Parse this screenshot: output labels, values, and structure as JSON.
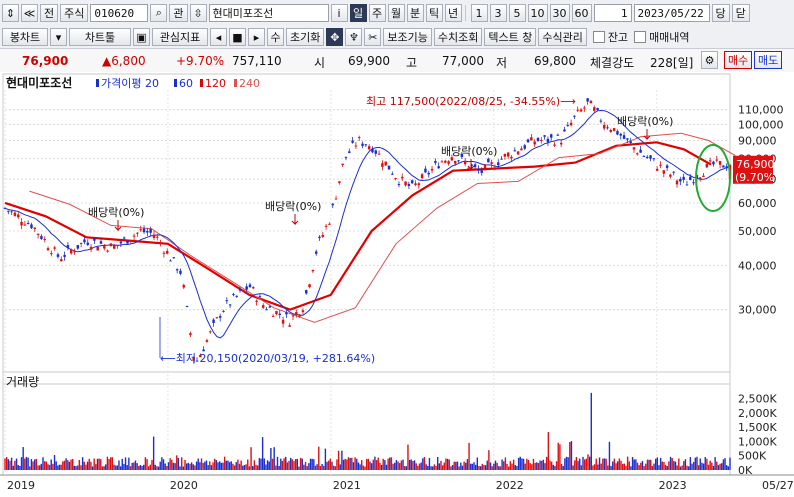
{
  "toolbar1": {
    "nav_up": "⇕",
    "nav_top": "≪",
    "btn_all": "전",
    "btn_stock": "주식",
    "code": "010620",
    "btn_gwan": "관",
    "btn_updown": "⇳",
    "stock_name": "현대미포조선",
    "btn_info": "i",
    "periods": [
      "일",
      "주",
      "월",
      "분",
      "틱",
      "년"
    ],
    "active_period": "일",
    "minute_units": [
      "1",
      "3",
      "5",
      "10",
      "30",
      "60"
    ],
    "count": "1",
    "date": "2023/05/22",
    "btn_dang": "당",
    "btn_close": "닫"
  },
  "toolbar2": {
    "candle": "봉차트",
    "chart_tool": "차트툴",
    "indicator": "관심지표",
    "su": "수",
    "reset": "초기화",
    "sub_func": "보조기능",
    "value_lookup": "수치조회",
    "text_window": "텍스트 창",
    "formula": "수식관리",
    "check_balance": "잔고",
    "check_trades": "매매내역"
  },
  "quote": {
    "price": "76,900",
    "change": "▲6,800",
    "change_pct": "+9.70%",
    "volume": "757,110",
    "open_label": "시",
    "open": "69,900",
    "high_label": "고",
    "high": "77,000",
    "low_label": "저",
    "low": "69,800",
    "strength_label": "체결강도",
    "strength": "228[일]",
    "buy": "매수",
    "sell": "매도"
  },
  "chart_data": {
    "type": "candlestick",
    "title": "현대미포조선",
    "legend": [
      {
        "name": "가격이평",
        "period": "20",
        "color": "#1a2fd0"
      },
      {
        "name": "",
        "period": "60",
        "color": "#1a2fd0"
      },
      {
        "name": "",
        "period": "120",
        "color": "#e00000"
      },
      {
        "name": "",
        "period": "240",
        "color": "#e05050"
      }
    ],
    "price_axis": {
      "scale": "log",
      "ticks": [
        110000,
        100000,
        90000,
        80000,
        70000,
        60000,
        50000,
        40000,
        30000
      ],
      "tick_labels": [
        "110,000",
        "100,000",
        "90,000",
        "80,000",
        "70,000",
        "60,000",
        "50,000",
        "40,000",
        "30,000"
      ]
    },
    "x_axis": {
      "labels": [
        "2019",
        "2020",
        "2021",
        "2022",
        "2023",
        "05/27"
      ]
    },
    "last_price_label": "76,900",
    "last_pct_label": "(9.70%)",
    "annotations": {
      "high": "최고 117,500(2022/08/25, -34.55%)⟶",
      "low": "⟵최저 20,150(2020/03/19, +281.64%)",
      "dividends": [
        "배당락(0%)",
        "배당락(0%)",
        "배당락(0%)",
        "배당락(0%)"
      ]
    },
    "price_path": [
      {
        "date": "2019/01",
        "close": 58000
      },
      {
        "date": "2019/03",
        "close": 52000
      },
      {
        "date": "2019/05",
        "close": 42000
      },
      {
        "date": "2019/07",
        "close": 47000
      },
      {
        "date": "2019/09",
        "close": 45000
      },
      {
        "date": "2019/11",
        "close": 50000
      },
      {
        "date": "2019/12",
        "close": 49000
      },
      {
        "date": "2020/02",
        "close": 38000
      },
      {
        "date": "2020/03",
        "close": 21000
      },
      {
        "date": "2020/05",
        "close": 30000
      },
      {
        "date": "2020/07",
        "close": 35000
      },
      {
        "date": "2020/08",
        "close": 31000
      },
      {
        "date": "2020/10",
        "close": 28000
      },
      {
        "date": "2020/11",
        "close": 31000
      },
      {
        "date": "2020/12",
        "close": 45000
      },
      {
        "date": "2021/01",
        "close": 55000
      },
      {
        "date": "2021/02",
        "close": 80000
      },
      {
        "date": "2021/03",
        "close": 90000
      },
      {
        "date": "2021/04",
        "close": 87000
      },
      {
        "date": "2021/06",
        "close": 70000
      },
      {
        "date": "2021/07",
        "close": 66000
      },
      {
        "date": "2021/09",
        "close": 78000
      },
      {
        "date": "2021/10",
        "close": 82000
      },
      {
        "date": "2021/12",
        "close": 73000
      },
      {
        "date": "2022/02",
        "close": 82000
      },
      {
        "date": "2022/04",
        "close": 90000
      },
      {
        "date": "2022/06",
        "close": 91000
      },
      {
        "date": "2022/07",
        "close": 105000
      },
      {
        "date": "2022/08",
        "close": 115000
      },
      {
        "date": "2022/09",
        "close": 102000
      },
      {
        "date": "2022/10",
        "close": 96000
      },
      {
        "date": "2022/11",
        "close": 88000
      },
      {
        "date": "2022/12",
        "close": 82000
      },
      {
        "date": "2023/01",
        "close": 77000
      },
      {
        "date": "2023/03",
        "close": 68000
      },
      {
        "date": "2023/04",
        "close": 72000
      },
      {
        "date": "2023/05",
        "close": 76900
      }
    ],
    "ma120_path": [
      {
        "date": "2019/01",
        "value": 60000
      },
      {
        "date": "2019/04",
        "value": 55000
      },
      {
        "date": "2019/07",
        "value": 48000
      },
      {
        "date": "2019/10",
        "value": 47000
      },
      {
        "date": "2020/01",
        "value": 46000
      },
      {
        "date": "2020/04",
        "value": 39000
      },
      {
        "date": "2020/07",
        "value": 33000
      },
      {
        "date": "2020/10",
        "value": 30000
      },
      {
        "date": "2021/01",
        "value": 33000
      },
      {
        "date": "2021/04",
        "value": 50000
      },
      {
        "date": "2021/07",
        "value": 63000
      },
      {
        "date": "2021/10",
        "value": 74000
      },
      {
        "date": "2022/01",
        "value": 75000
      },
      {
        "date": "2022/04",
        "value": 76000
      },
      {
        "date": "2022/07",
        "value": 78000
      },
      {
        "date": "2022/10",
        "value": 87000
      },
      {
        "date": "2023/01",
        "value": 89000
      },
      {
        "date": "2023/03",
        "value": 85000
      },
      {
        "date": "2023/05",
        "value": 77000
      }
    ],
    "volume_axis": {
      "ticks": [
        2500000,
        2000000,
        1500000,
        1000000,
        500000,
        0
      ],
      "tick_labels": [
        "2,500K",
        "2,000K",
        "1,500K",
        "1,000K",
        "500K",
        "0K"
      ]
    },
    "volume_pane_title": "거래량"
  }
}
